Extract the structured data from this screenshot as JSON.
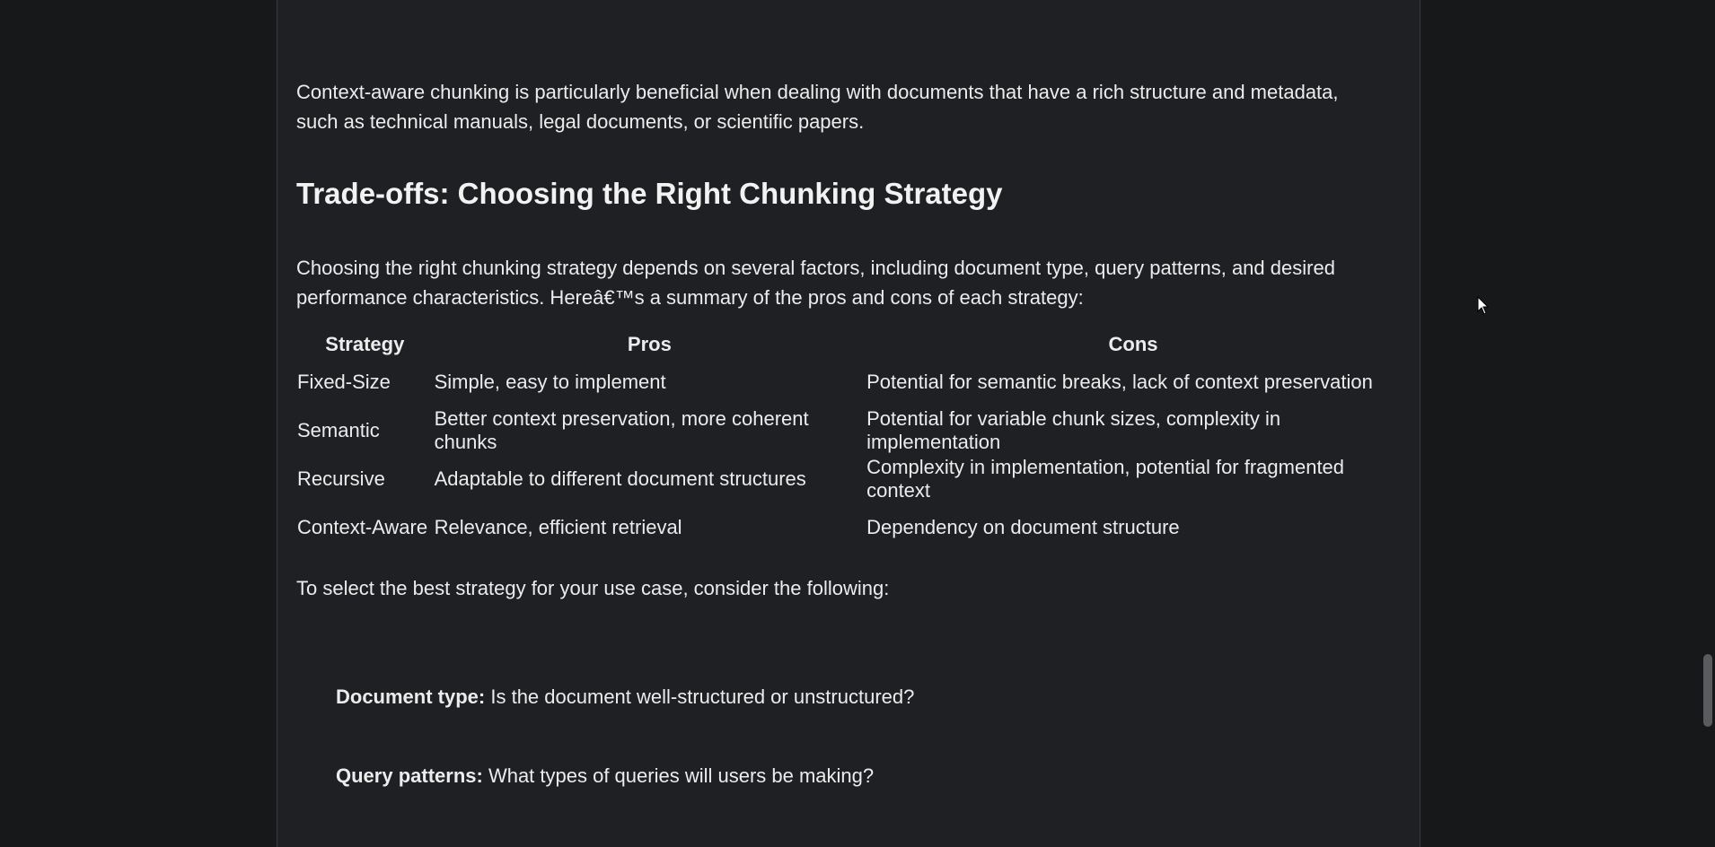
{
  "document": {
    "intro_paragraph": "Context-aware chunking is particularly beneficial when dealing with documents that have a rich structure and metadata, such as technical manuals, legal documents, or scientific papers.",
    "section_heading": "Trade-offs: Choosing the Right Chunking Strategy",
    "summary_paragraph": "Choosing the right chunking strategy depends on several factors, including document type, query patterns, and desired performance characteristics. Hereâ€™s a summary of the pros and cons of each strategy:",
    "table": {
      "headers": [
        "Strategy",
        "Pros",
        "Cons"
      ],
      "rows": [
        [
          "Fixed-Size",
          "Simple, easy to implement",
          "Potential for semantic breaks, lack of context preservation"
        ],
        [
          "Semantic",
          "Better context preservation, more coherent chunks",
          "Potential for variable chunk sizes, complexity in implementation"
        ],
        [
          "Recursive",
          "Adaptable to different document structures",
          "Complexity in implementation, potential for fragmented context"
        ],
        [
          "Context-Aware",
          "Relevance, efficient retrieval",
          "Dependency on document structure"
        ]
      ]
    },
    "select_paragraph": "To select the best strategy for your use case, consider the following:",
    "considerations": [
      {
        "label": "Document type:",
        "text": " Is the document well-structured or unstructured?"
      },
      {
        "label": "Query patterns:",
        "text": " What types of queries will users be making?"
      },
      {
        "label": "",
        "text": ""
      }
    ]
  },
  "icons": {
    "cursor": "mouse-pointer-icon"
  },
  "colors": {
    "page_background": "#17181a",
    "document_background": "#1f2023",
    "text": "#ececec",
    "scrollbar_thumb": "#5a5b5e"
  }
}
